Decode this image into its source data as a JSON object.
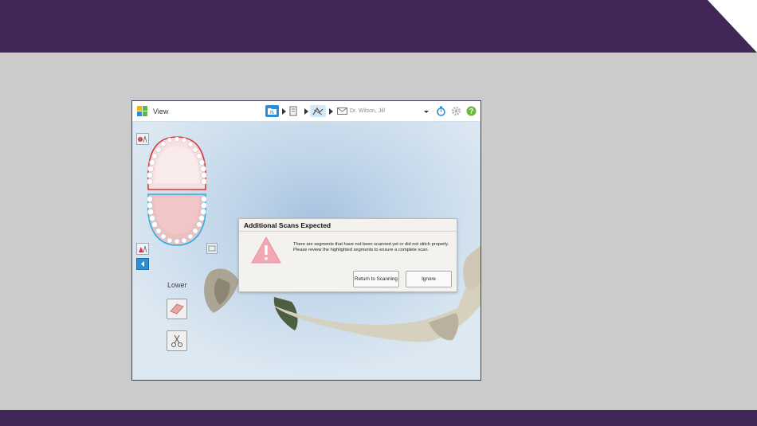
{
  "slide": {
    "band_color": "#412757",
    "background_color": "#cbcbcb"
  },
  "app": {
    "view_label": "View",
    "workflow_steps": [
      "rx-icon",
      "document-icon",
      "scan-icon",
      "send-icon"
    ],
    "active_step": "scan-icon",
    "patient_name": "Dr. Wilson, Jill",
    "toolbar_icons": [
      "timer-icon",
      "gear-icon",
      "help-icon"
    ],
    "accent_color": "#2a8fd6"
  },
  "jaw_panel": {
    "current_jaw_label": "Lower",
    "upper_outline_color": "#d23a3a",
    "lower_outline_color": "#2eb0e0",
    "tools": [
      "eraser-tool-icon",
      "trim-scissors-icon"
    ]
  },
  "dialog": {
    "title": "Additional Scans Expected",
    "message": "There are segments that have not been scanned yet or did not stitch properly. Please review the highlighted segments to ensure a complete scan.",
    "warning_color": "#f2a8b3",
    "buttons": {
      "return_label": "Return to Scanning",
      "ignore_label": "Ignore"
    }
  }
}
